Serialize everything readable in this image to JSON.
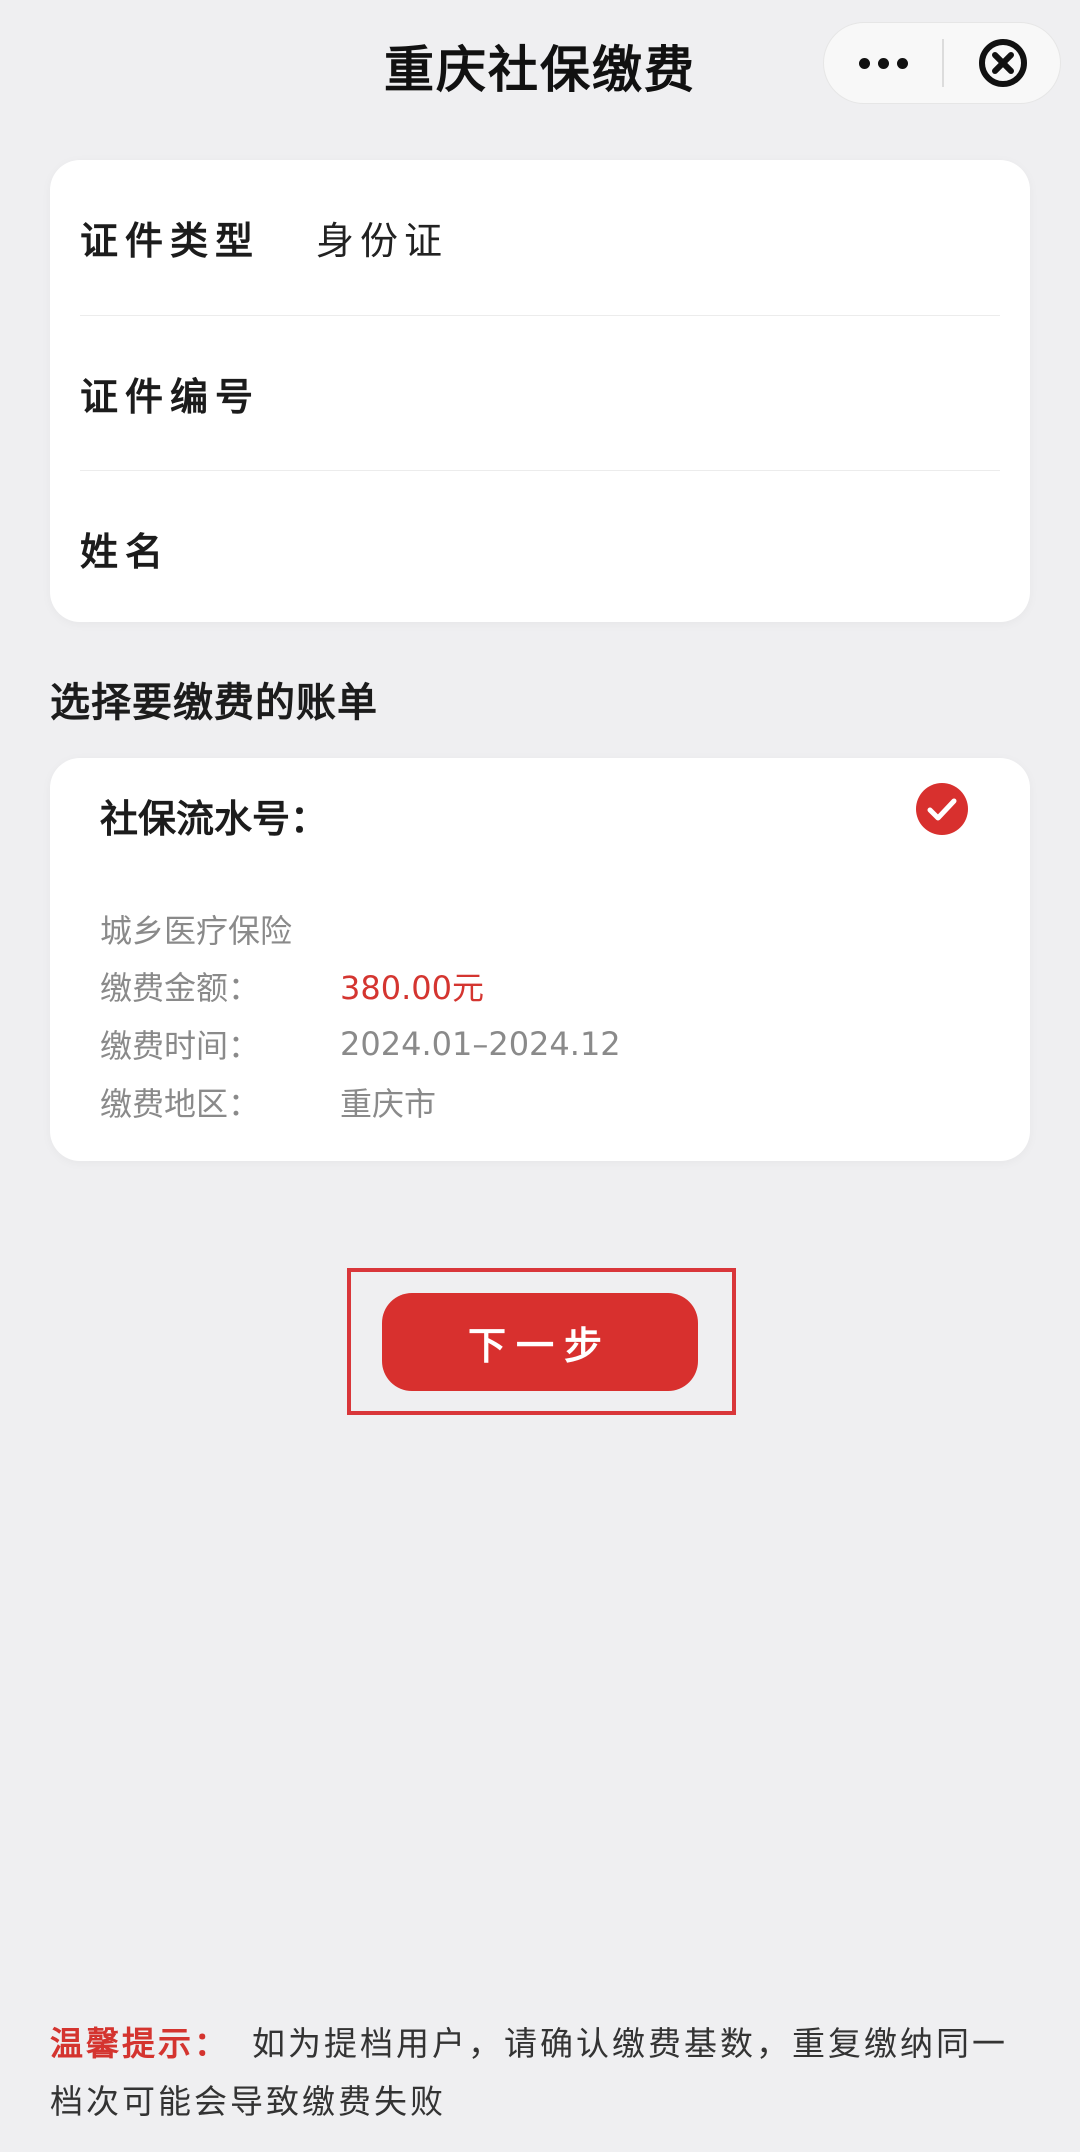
{
  "header": {
    "title": "重庆社保缴费",
    "more_icon": "more-dots-icon",
    "close_icon": "close-circle-icon"
  },
  "form": {
    "rows": [
      {
        "label": "证件类型",
        "value": "身份证"
      },
      {
        "label": "证件编号",
        "value": ""
      },
      {
        "label": "姓名",
        "value": ""
      }
    ]
  },
  "bills": {
    "section_title": "选择要缴费的账单",
    "serial_label": "社保流水号：",
    "selected": true,
    "item_name": "城乡医疗保险",
    "fields": [
      {
        "label": "缴费金额：",
        "value": "380.00元"
      },
      {
        "label": "缴费时间：",
        "value": "2024.01–2024.12"
      },
      {
        "label": "缴费地区：",
        "value": "重庆市"
      }
    ]
  },
  "next_button": {
    "label": "下一步"
  },
  "tip": {
    "label": "温馨提示：",
    "text": "如为提档用户，请确认缴费基数，重复缴纳同一档次可能会导致缴费失败"
  },
  "colors": {
    "accent": "#d8302e",
    "background": "#efeff1",
    "amount": "#d43530"
  }
}
